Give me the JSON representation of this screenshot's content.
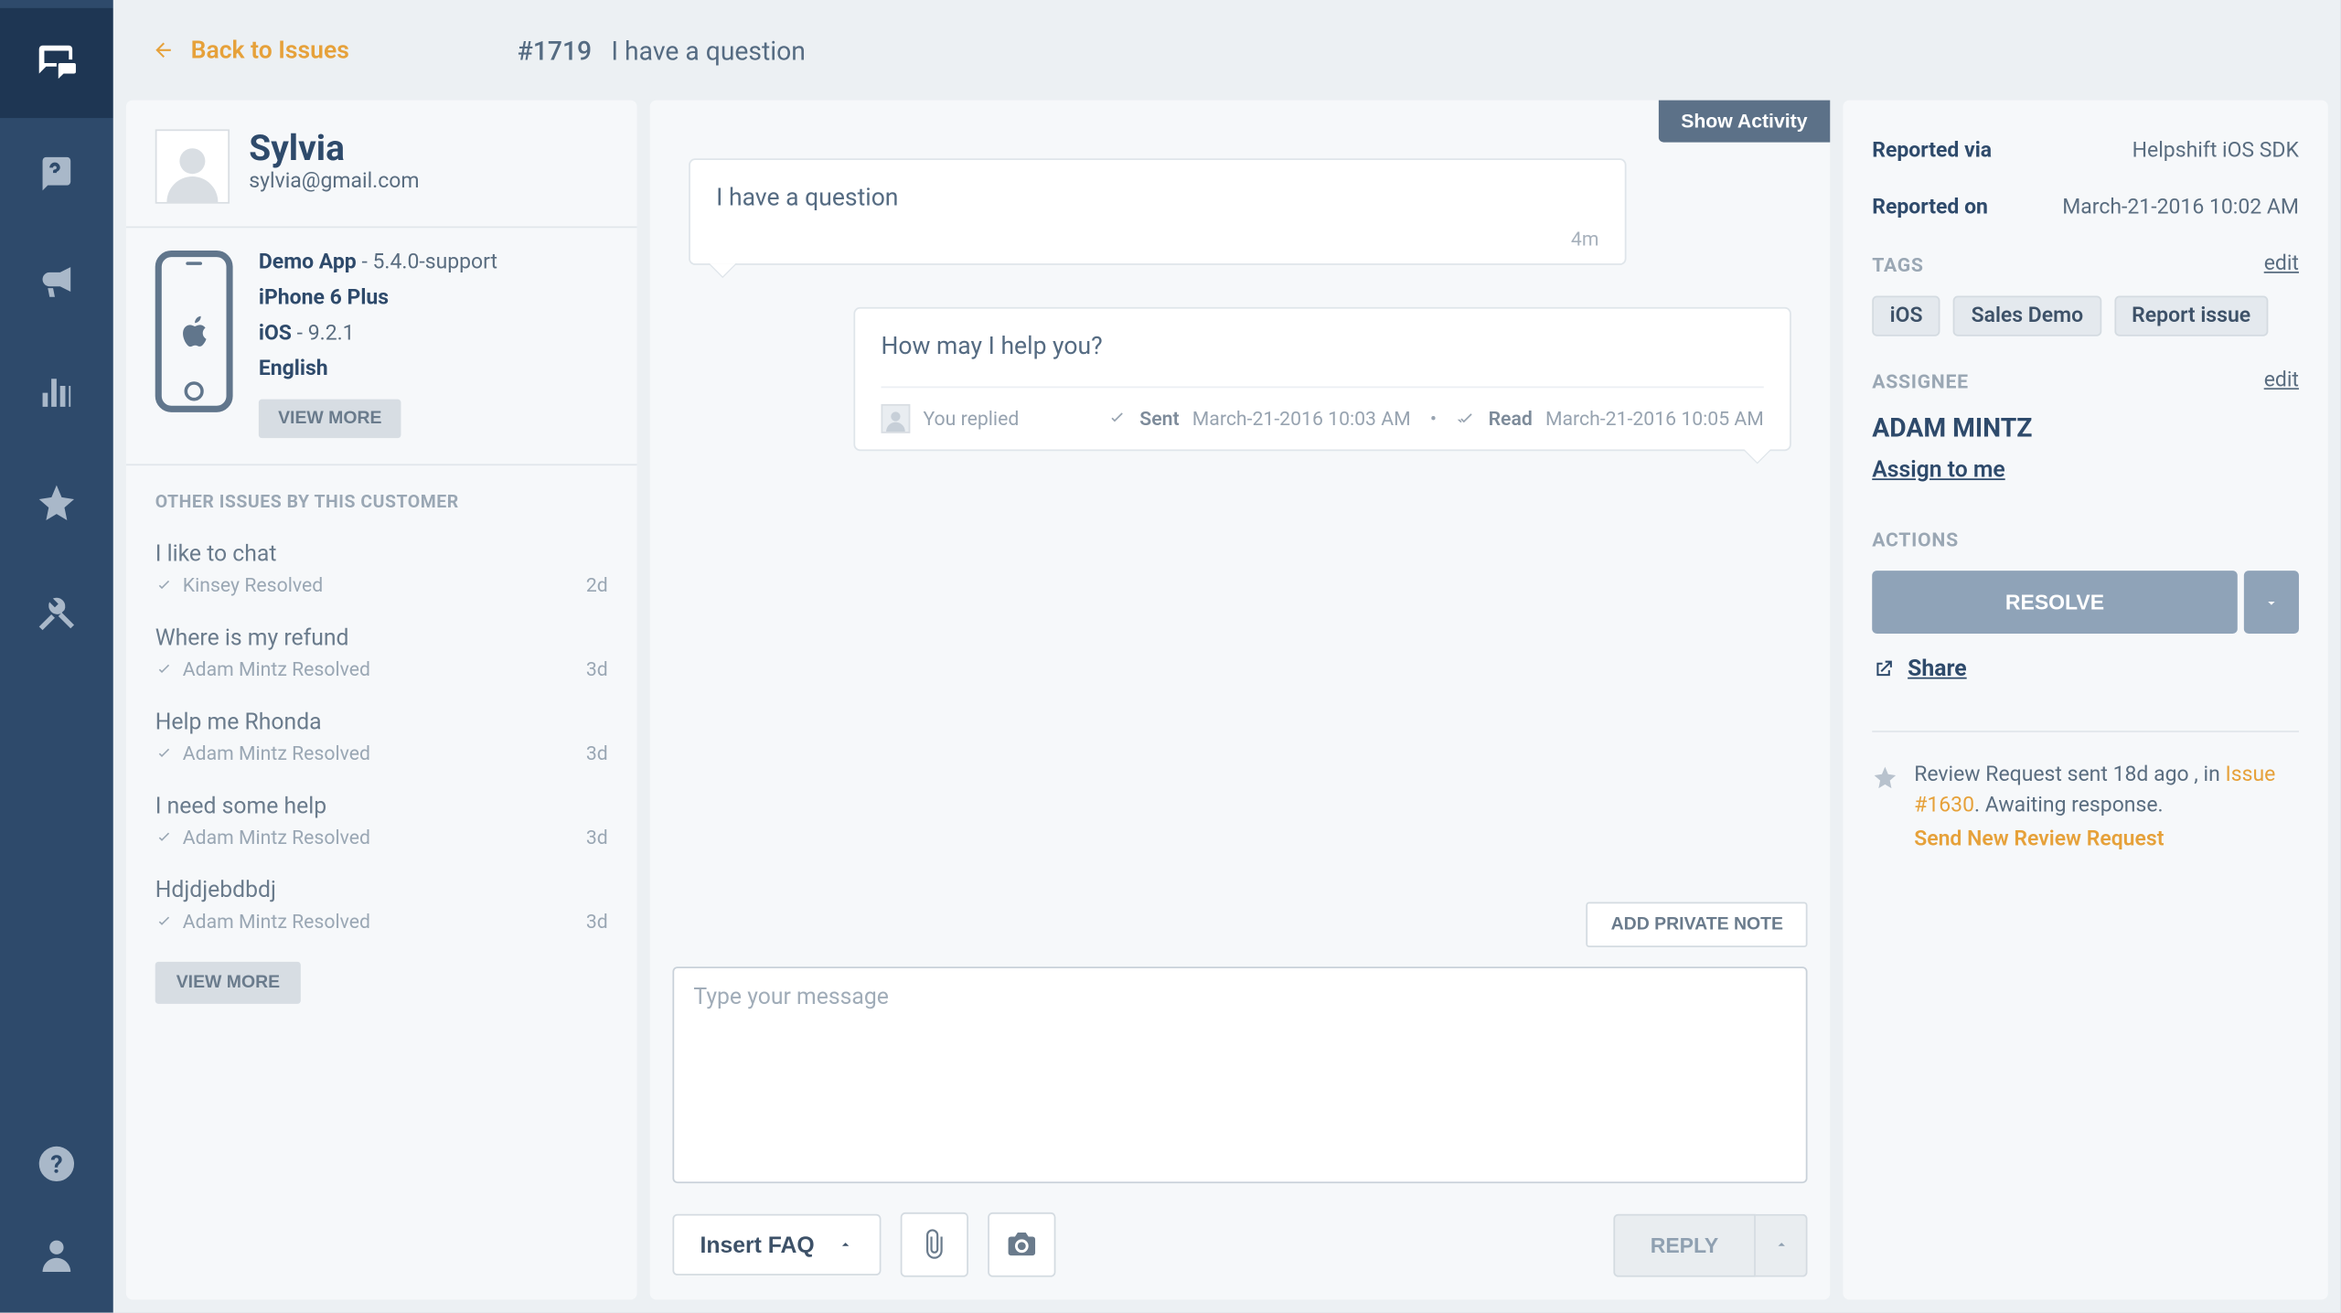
{
  "nav": {
    "back_label": "Back to Issues"
  },
  "issue": {
    "number": "#1719",
    "title": "I have a question"
  },
  "customer": {
    "name": "Sylvia",
    "email": "sylvia@gmail.com",
    "app_name": "Demo App",
    "app_version": " - 5.4.0-support",
    "device": "iPhone 6 Plus",
    "os_name": "iOS",
    "os_version": " - 9.2.1",
    "language": "English",
    "view_more": "VIEW MORE"
  },
  "other_issues": {
    "heading": "OTHER ISSUES BY THIS CUSTOMER",
    "view_more": "VIEW MORE",
    "items": [
      {
        "title": "I like to chat",
        "resolver": "Kinsey Resolved",
        "ago": "2d"
      },
      {
        "title": "Where is my refund",
        "resolver": "Adam Mintz Resolved",
        "ago": "3d"
      },
      {
        "title": "Help me Rhonda",
        "resolver": "Adam Mintz Resolved",
        "ago": "3d"
      },
      {
        "title": "I need some help",
        "resolver": "Adam Mintz Resolved",
        "ago": "3d"
      },
      {
        "title": "Hdjdjebdbdj",
        "resolver": "Adam Mintz Resolved",
        "ago": "3d"
      }
    ]
  },
  "convo": {
    "show_activity": "Show Activity",
    "incoming": {
      "text": "I have a question",
      "time": "4m"
    },
    "outgoing": {
      "text": "How may I help you?",
      "you_replied": "You replied",
      "sent_label": "Sent",
      "sent_time": "March-21-2016 10:03 AM",
      "read_label": "Read",
      "read_time": "March-21-2016 10:05 AM"
    },
    "add_private_note": "ADD PRIVATE NOTE",
    "placeholder": "Type your message",
    "insert_faq": "Insert FAQ",
    "reply": "REPLY"
  },
  "right": {
    "reported_via_label": "Reported via",
    "reported_via_value": "Helpshift iOS SDK",
    "reported_on_label": "Reported on",
    "reported_on_value": "March-21-2016 10:02 AM",
    "tags_heading": "TAGS",
    "edit": "edit",
    "tags": [
      "iOS",
      "Sales Demo",
      "Report issue"
    ],
    "assignee_heading": "ASSIGNEE",
    "assignee_name": "ADAM MINTZ",
    "assign_to_me": "Assign to me",
    "actions_heading": "ACTIONS",
    "resolve": "RESOLVE",
    "share": "Share",
    "review_prefix": "Review Request sent 18d ago , in ",
    "review_issue": "Issue #1630",
    "review_suffix": ". Awaiting response.",
    "send_new_review": "Send New Review Request"
  }
}
